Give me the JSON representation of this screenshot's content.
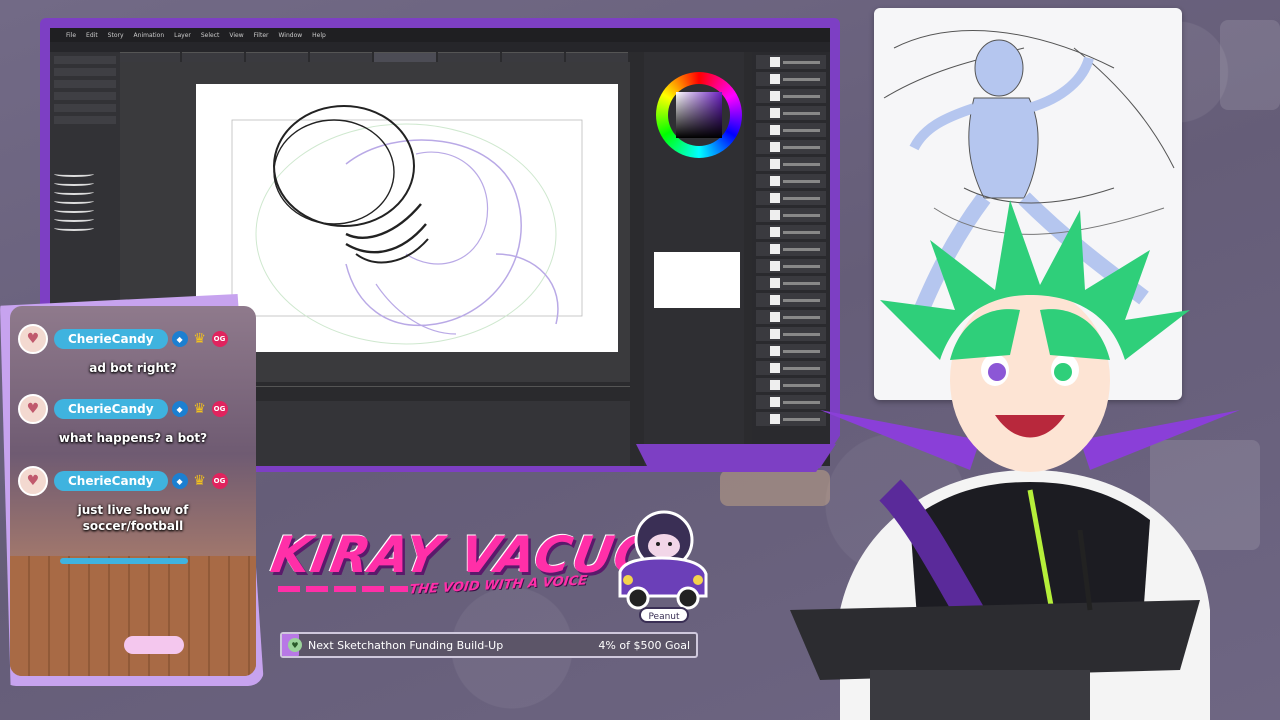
{
  "app": {
    "menu": [
      "File",
      "Edit",
      "Story",
      "Animation",
      "Layer",
      "Select",
      "View",
      "Filter",
      "Window",
      "Help"
    ]
  },
  "chat": {
    "messages": [
      {
        "user": "CherieCandy",
        "text": "ad bot right?",
        "badges": [
          "drop",
          "crown",
          "OG"
        ]
      },
      {
        "user": "CherieCandy",
        "text": "what happens? a bot?",
        "badges": [
          "drop",
          "crown",
          "OG"
        ]
      },
      {
        "user": "CherieCandy",
        "text": "just live show of soccer/football",
        "badges": [
          "drop",
          "crown",
          "OG"
        ]
      }
    ]
  },
  "logo": {
    "title": "KIRAY VACUO",
    "subtitle": "THE VOID WITH A VOICE",
    "mascot_label": "Peanut"
  },
  "goal": {
    "label": "Next Sketchathon Funding Build-Up",
    "progress_text": "4% of $500 Goal",
    "progress_fraction": 0.04
  },
  "colors": {
    "accent": "#7d3fc4",
    "chat_name": "#3fb3df",
    "logo_pink": "#ff2fa8",
    "avatar_hair": "#2fcf7a"
  }
}
